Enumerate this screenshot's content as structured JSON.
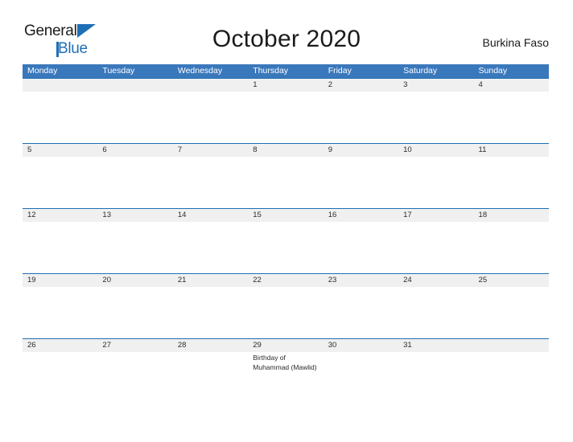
{
  "brand": {
    "name_part1": "General",
    "name_part2": "Blue",
    "accent_color": "#1f6fb5"
  },
  "header": {
    "title": "October 2020",
    "region": "Burkina Faso"
  },
  "colors": {
    "header_bar": "#3a78bc",
    "date_strip": "#f0f0f0",
    "strip_border": "#1f6fb5",
    "text": "#2b2b2b"
  },
  "calendar": {
    "weekdays": [
      "Monday",
      "Tuesday",
      "Wednesday",
      "Thursday",
      "Friday",
      "Saturday",
      "Sunday"
    ],
    "weeks": [
      [
        {
          "date": "",
          "event": ""
        },
        {
          "date": "",
          "event": ""
        },
        {
          "date": "",
          "event": ""
        },
        {
          "date": "1",
          "event": ""
        },
        {
          "date": "2",
          "event": ""
        },
        {
          "date": "3",
          "event": ""
        },
        {
          "date": "4",
          "event": ""
        }
      ],
      [
        {
          "date": "5",
          "event": ""
        },
        {
          "date": "6",
          "event": ""
        },
        {
          "date": "7",
          "event": ""
        },
        {
          "date": "8",
          "event": ""
        },
        {
          "date": "9",
          "event": ""
        },
        {
          "date": "10",
          "event": ""
        },
        {
          "date": "11",
          "event": ""
        }
      ],
      [
        {
          "date": "12",
          "event": ""
        },
        {
          "date": "13",
          "event": ""
        },
        {
          "date": "14",
          "event": ""
        },
        {
          "date": "15",
          "event": ""
        },
        {
          "date": "16",
          "event": ""
        },
        {
          "date": "17",
          "event": ""
        },
        {
          "date": "18",
          "event": ""
        }
      ],
      [
        {
          "date": "19",
          "event": ""
        },
        {
          "date": "20",
          "event": ""
        },
        {
          "date": "21",
          "event": ""
        },
        {
          "date": "22",
          "event": ""
        },
        {
          "date": "23",
          "event": ""
        },
        {
          "date": "24",
          "event": ""
        },
        {
          "date": "25",
          "event": ""
        }
      ],
      [
        {
          "date": "26",
          "event": ""
        },
        {
          "date": "27",
          "event": ""
        },
        {
          "date": "28",
          "event": ""
        },
        {
          "date": "29",
          "event": "Birthday of Muhammad (Mawlid)"
        },
        {
          "date": "30",
          "event": ""
        },
        {
          "date": "31",
          "event": ""
        },
        {
          "date": "",
          "event": ""
        }
      ]
    ]
  }
}
